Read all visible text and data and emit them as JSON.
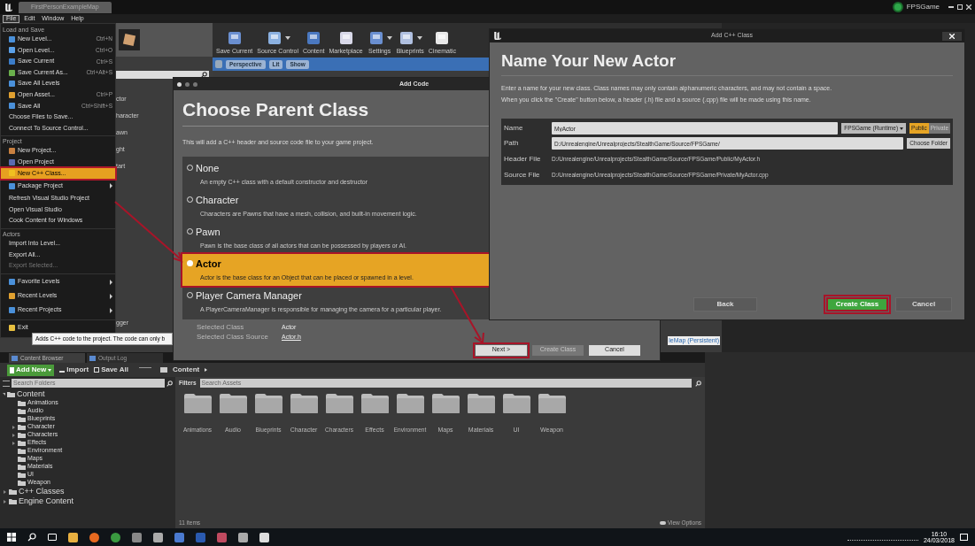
{
  "title_bar": {
    "tab": "FirstPersonExampleMap",
    "project": "FPSGame"
  },
  "menu_bar": [
    {
      "label": "File",
      "selected": true
    },
    {
      "label": "Edit",
      "selected": false
    },
    {
      "label": "Window",
      "selected": false
    },
    {
      "label": "Help",
      "selected": false
    }
  ],
  "file_menu": [
    {
      "heading": "Load and Save",
      "items": [
        {
          "kind": "command",
          "label": "New Level...",
          "shortcut": "Ctrl+N",
          "selected": false,
          "disabled": false
        },
        {
          "kind": "command",
          "label": "Open Level...",
          "shortcut": "Ctrl+O",
          "selected": false,
          "disabled": false
        },
        {
          "kind": "command",
          "label": "Save Current",
          "shortcut": "Ctrl+S",
          "selected": false,
          "disabled": false
        },
        {
          "kind": "command",
          "label": "Save Current As...",
          "shortcut": "Ctrl+Alt+S",
          "selected": false,
          "disabled": false
        },
        {
          "kind": "command",
          "label": "Save All Levels",
          "selected": false,
          "disabled": false
        },
        {
          "kind": "command",
          "label": "Open Asset...",
          "shortcut": "Ctrl+P",
          "selected": false,
          "disabled": false
        },
        {
          "kind": "command",
          "label": "Save All",
          "shortcut": "Ctrl+Shift+S",
          "selected": false,
          "disabled": false
        },
        {
          "kind": "plain",
          "label": "Choose Files to Save...",
          "selected": false,
          "disabled": false
        },
        {
          "kind": "plain",
          "label": "Connect To Source Control...",
          "selected": false,
          "disabled": false
        }
      ]
    },
    {
      "heading": "Project",
      "items": [
        {
          "kind": "command",
          "label": "New Project...",
          "selected": false,
          "disabled": false
        },
        {
          "kind": "command",
          "label": "Open Project",
          "selected": false,
          "disabled": false
        },
        {
          "kind": "command",
          "label": "New C++ Class...",
          "selected": true,
          "disabled": false
        },
        {
          "kind": "submenu",
          "label": "Package Project",
          "selected": false,
          "disabled": false
        },
        {
          "kind": "plain",
          "label": "Refresh Visual Studio Project",
          "selected": false,
          "disabled": false
        },
        {
          "kind": "plain",
          "label": "Open Visual Studio",
          "selected": false,
          "disabled": false
        },
        {
          "kind": "plain",
          "label": "Cook Content for Windows",
          "selected": false,
          "disabled": false
        }
      ]
    },
    {
      "heading": "Actors",
      "items": [
        {
          "kind": "plain",
          "label": "Import Into Level...",
          "selected": false,
          "disabled": false
        },
        {
          "kind": "plain",
          "label": "Export All...",
          "selected": false,
          "disabled": false
        },
        {
          "kind": "plain",
          "label": "Export Selected...",
          "selected": false,
          "disabled": true
        }
      ]
    },
    {
      "items": [
        {
          "kind": "submenu",
          "label": "Favorite Levels",
          "selected": false,
          "disabled": false
        },
        {
          "kind": "submenu",
          "label": "Recent Levels",
          "selected": false,
          "disabled": false
        },
        {
          "kind": "submenu",
          "label": "Recent Projects",
          "selected": false,
          "disabled": false
        }
      ]
    },
    {
      "items": [
        {
          "kind": "command",
          "label": "Exit",
          "selected": false,
          "disabled": false
        }
      ]
    }
  ],
  "tooltip": "Adds C++ code to the project. The code can only b",
  "place_panel": {
    "items": [
      "ctor",
      "haracter",
      "awn",
      "ght",
      "tart"
    ],
    "last": "gger"
  },
  "toolbar": [
    {
      "label": "Save Current",
      "dropdown": false
    },
    {
      "label": "Source Control",
      "dropdown": true
    },
    {
      "label": "Content",
      "dropdown": false
    },
    {
      "label": "Marketplace",
      "dropdown": false
    },
    {
      "label": "Settings",
      "dropdown": true
    },
    {
      "label": "Blueprints",
      "dropdown": true
    },
    {
      "label": "Cinematic",
      "dropdown": false
    }
  ],
  "viewport_bar": [
    "Perspective",
    "Lit",
    "Show"
  ],
  "level_label": "leMap (Persistent)",
  "add_code": {
    "title": "Add Code",
    "heading": "Choose Parent Class",
    "description": "This will add a C++ header and source code file to your game project.",
    "options": [
      {
        "name": "None",
        "description": "An empty C++ class with a default constructor and destructor",
        "selected": false
      },
      {
        "name": "Character",
        "description": "Characters are Pawns that have a mesh, collision, and built-in movement logic.",
        "selected": false
      },
      {
        "name": "Pawn",
        "description": "Pawn is the base class of all actors that can be possessed by players or AI.",
        "selected": false
      },
      {
        "name": "Actor",
        "description": "Actor is the base class for an Object that can be placed or spawned in a level.",
        "selected": true
      },
      {
        "name": "Player Camera Manager",
        "description": "A PlayerCameraManager is responsible for managing the camera for a particular player.",
        "selected": false
      }
    ],
    "selected_class": {
      "label": "Selected Class",
      "value": "Actor"
    },
    "selected_source": {
      "label": "Selected Class Source",
      "value": "Actor.h"
    },
    "buttons": [
      {
        "label": "Next >",
        "disabled": false,
        "annotated": true
      },
      {
        "label": "Create Class",
        "disabled": true,
        "annotated": false
      },
      {
        "label": "Cancel",
        "disabled": false,
        "annotated": false
      }
    ]
  },
  "add_class": {
    "title": "Add C++ Class",
    "heading": "Name Your New Actor",
    "description": [
      "Enter a name for your new class. Class names may only contain alphanumeric characters, and may not contain a space.",
      "When you click the \"Create\" button below, a header (.h) file and a source (.cpp) file will be made using this name."
    ],
    "name": {
      "label": "Name",
      "value": "MyActor"
    },
    "module": "FPSGame (Runtime)",
    "visibility": [
      {
        "label": "Public",
        "selected": true
      },
      {
        "label": "Private",
        "selected": false
      }
    ],
    "path": {
      "label": "Path",
      "value": "D:/Unrealengine/Unrealprojects/StealthGame/Source/FPSGame/"
    },
    "choose_folder": "Choose Folder",
    "header_file": {
      "label": "Header File",
      "value": "D:/Unrealengine/Unrealprojects/StealthGame/Source/FPSGame/Public/MyActor.h"
    },
    "source_file": {
      "label": "Source File",
      "value": "D:/Unrealengine/Unrealprojects/StealthGame/Source/FPSGame/Private/MyActor.cpp"
    },
    "buttons": [
      {
        "kind": "back",
        "label": "Back",
        "annotated": false
      },
      {
        "kind": "primary",
        "label": "Create Class",
        "annotated": true
      },
      {
        "kind": "plain",
        "label": "Cancel",
        "annotated": false
      }
    ]
  },
  "content_browser": {
    "tabs": [
      {
        "label": "Content Browser",
        "selected": true
      },
      {
        "label": "Output Log",
        "selected": false
      }
    ],
    "toolbar": {
      "add_new": "Add New",
      "import": "Import",
      "save_all": "Save All"
    },
    "path": "Content",
    "folder_search": {
      "placeholder": "Search Folders"
    },
    "filters": "Filters",
    "asset_search": {
      "placeholder": "Search Assets"
    },
    "tree": [
      {
        "label": "Content",
        "expanded": true,
        "children": [
          {
            "label": "Animations"
          },
          {
            "label": "Audio"
          },
          {
            "label": "Blueprints"
          },
          {
            "label": "Character",
            "expanded": false
          },
          {
            "label": "Characters",
            "expanded": false
          },
          {
            "label": "Effects",
            "expanded": false
          },
          {
            "label": "Environment"
          },
          {
            "label": "Maps"
          },
          {
            "label": "Materials"
          },
          {
            "label": "UI"
          },
          {
            "label": "Weapon"
          }
        ]
      },
      {
        "label": "C++ Classes",
        "expanded": false
      },
      {
        "label": "Engine Content",
        "expanded": false
      }
    ],
    "folders": [
      "Animations",
      "Audio",
      "Blueprints",
      "Character",
      "Characters",
      "Effects",
      "Environment",
      "Maps",
      "Materials",
      "UI",
      "Weapon"
    ],
    "count": "11 items",
    "view_options": "View Options"
  },
  "taskbar": {
    "time": "16:10",
    "date": "24/03/2018"
  }
}
